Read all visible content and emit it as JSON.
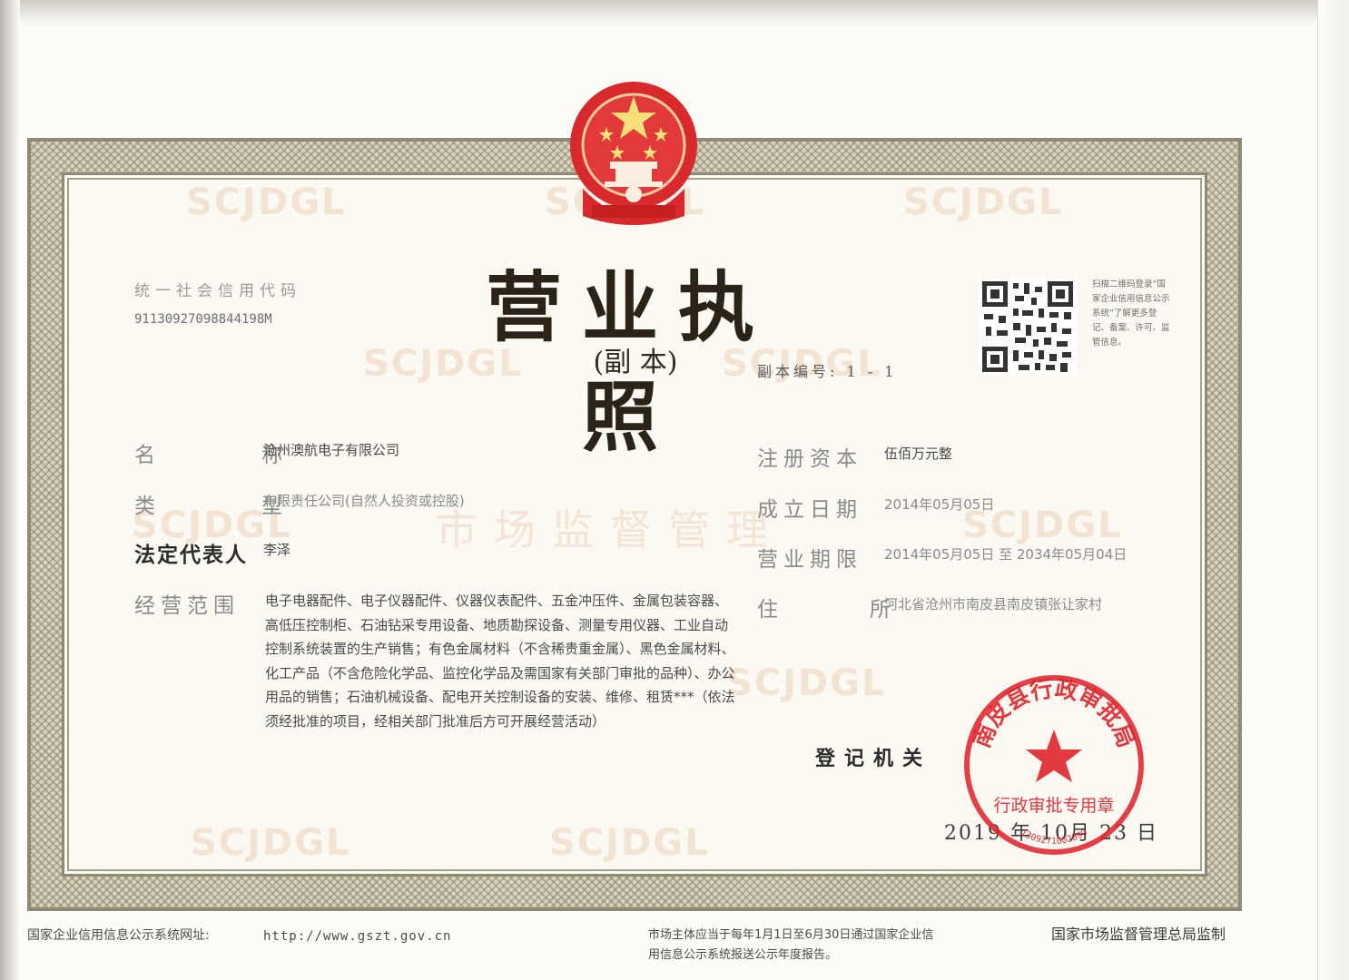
{
  "document": {
    "title": "营业执照",
    "subtitle": "(副 本)",
    "watermark_text": "SCJDGL",
    "watermark_center": "市场监督管理",
    "credit_code_label": "统一社会信用代码",
    "credit_code": "91130927098844198M",
    "copy_number": "副本编号: 1 - 1",
    "qr_note": "扫描二维码登录“国家企业信用信息公示系统”了解更多登记、备案、许可、监管信息。"
  },
  "fields": {
    "name_label": "名　　　称",
    "name_value": "沧州澳航电子有限公司",
    "type_label": "类　　　型",
    "type_value": "有限责任公司(自然人投资或控股)",
    "legal_rep_label": "法定代表人",
    "legal_rep_value": "李泽",
    "scope_label": "经营范围",
    "scope_value": "电子电器配件、电子仪器配件、仪器仪表配件、五金冲压件、金属包装容器、高低压控制柜、石油钻采专用设备、地质勘探设备、测量专用仪器、工业自动控制系统装置的生产销售；有色金属材料（不含稀贵重金属）、黑色金属材料、化工产品（不含危险化学品、监控化学品及需国家有关部门审批的品种）、办公用品的销售；石油机械设备、配电开关控制设备的安装、维修、租赁***（依法须经批准的项目，经相关部门批准后方可开展经营活动）",
    "capital_label": "注册资本",
    "capital_value": "伍佰万元整",
    "established_label": "成立日期",
    "established_value": "2014年05月05日",
    "term_label": "营业期限",
    "term_value": "2014年05月05日 至 2034年05月04日",
    "address_label": "住　　　所",
    "address_value": "河北省沧州市南皮县南皮镇张让家村"
  },
  "issuer": {
    "authority_label": "登记机关",
    "date": "2019 年 10月 23 日",
    "seal_text": "南皮县行政审批局",
    "seal_sub": "行政审批专用章",
    "seal_code": "1309271002099"
  },
  "footer": {
    "system_label": "国家企业信用信息公示系统网址:",
    "url": "http://www.gszt.gov.cn",
    "notice": "市场主体应当于每年1月1日至6月30日通过国家企业信用信息公示系统报送公示年度报告。",
    "supervisor": "国家市场监督管理总局监制"
  },
  "colors": {
    "seal_red": "#e0242d",
    "frame": "#8f8a74"
  }
}
